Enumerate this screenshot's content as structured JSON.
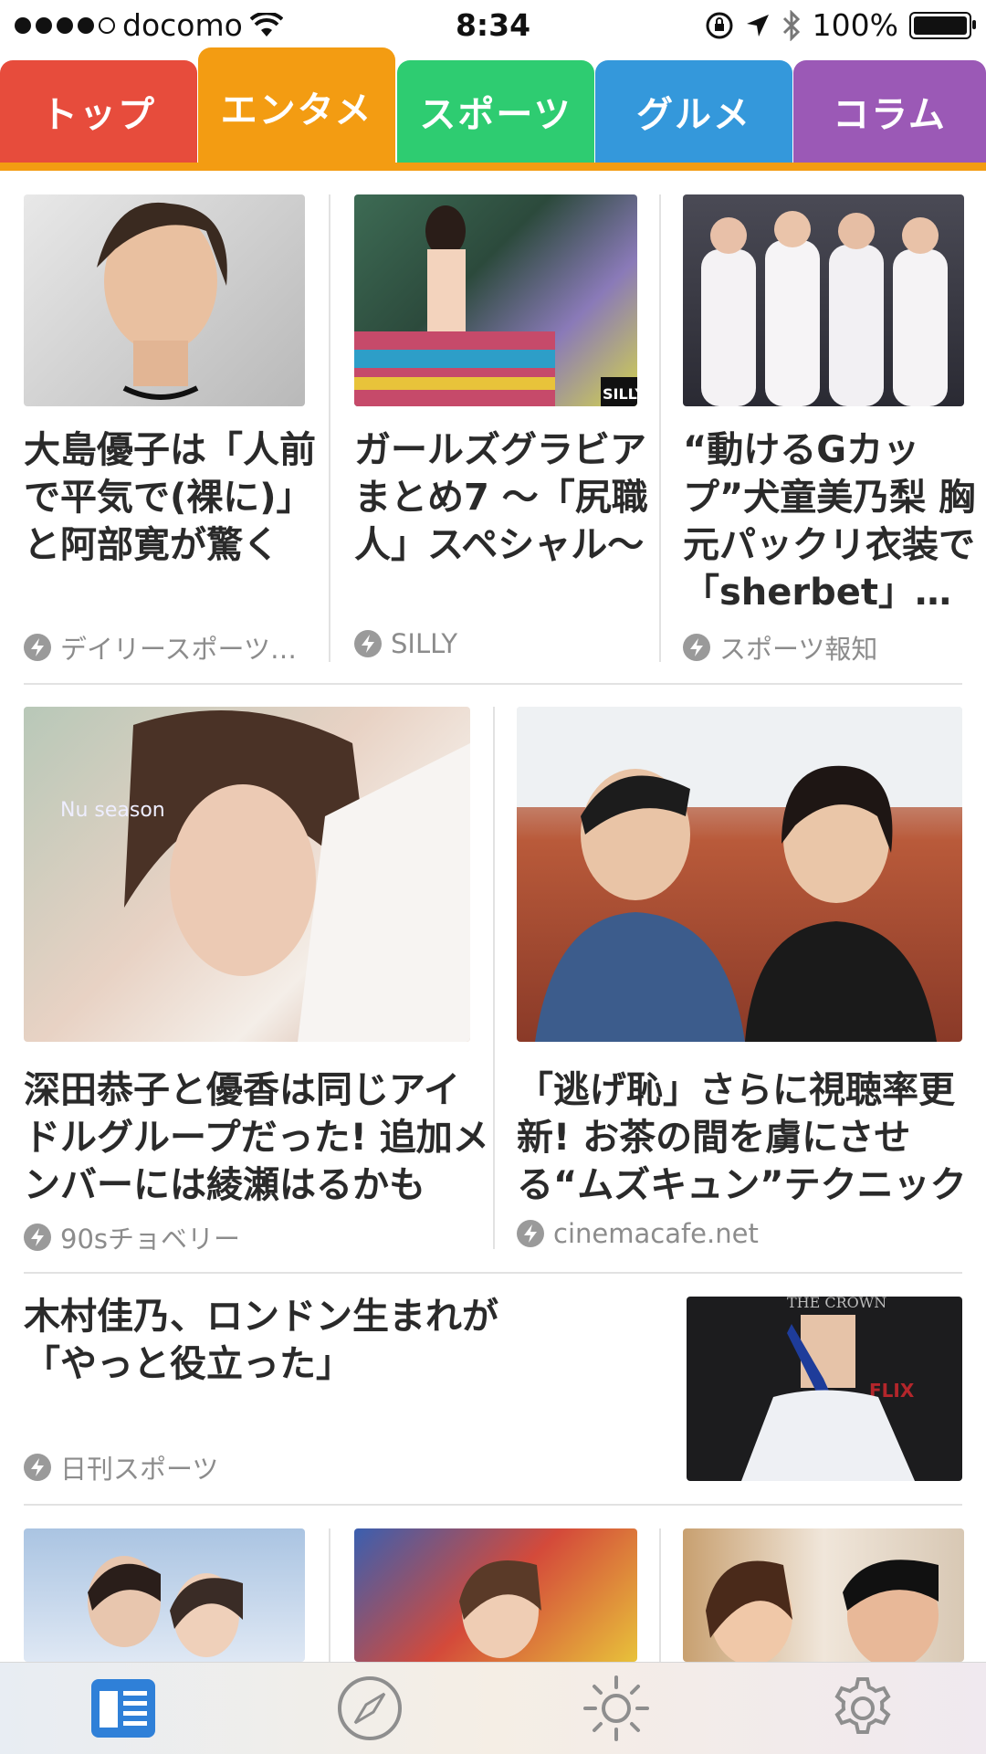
{
  "status": {
    "carrier": "docomo",
    "time": "8:34",
    "battery": "100%"
  },
  "tabs": [
    {
      "label": "トップ",
      "color": "#e74c3c"
    },
    {
      "label": "エンタメ",
      "color": "#f39c12",
      "active": true
    },
    {
      "label": "スポーツ",
      "color": "#2ecc71"
    },
    {
      "label": "グルメ",
      "color": "#3498db"
    },
    {
      "label": "コラム",
      "color": "#9b59b6"
    }
  ],
  "row1": [
    {
      "headline": "大島優子は「人前で平気で(裸に)」と阿部寛が驚く",
      "source": "デイリースポーツ…"
    },
    {
      "headline": "ガールズグラビアまとめ7 ～「尻職人」スペシャル～",
      "source": "SILLY"
    },
    {
      "headline": "“動けるGカップ”犬童美乃梨 胸元パックリ衣装で「sherbet」…",
      "source": "スポーツ報知"
    }
  ],
  "row2": [
    {
      "headline": "深田恭子と優香は同じアイドルグループだった! 追加メンバーには綾瀬はるかも",
      "source": "90sチョベリー"
    },
    {
      "headline": "「逃げ恥」さらに視聴率更新! お茶の間を虜にさせる“ムズキュン”テクニック",
      "source": "cinemacafe.net"
    }
  ],
  "row3": {
    "headline": "木村佳乃、ロンドン生まれが「やっと役立った」",
    "source": "日刊スポーツ"
  },
  "image_text": {
    "album": "Nu season",
    "crown": "THE CROWN",
    "netflix": "FLIX",
    "silly": "SILLY"
  },
  "bottom_tabs": [
    {
      "icon": "news-icon",
      "active": true
    },
    {
      "icon": "compass-icon"
    },
    {
      "icon": "weather-icon"
    },
    {
      "icon": "settings-icon"
    }
  ],
  "colors": {
    "active_icon": "#2f80d8",
    "inactive_icon": "#8e8e8e",
    "source_text": "#8c8c8c"
  }
}
